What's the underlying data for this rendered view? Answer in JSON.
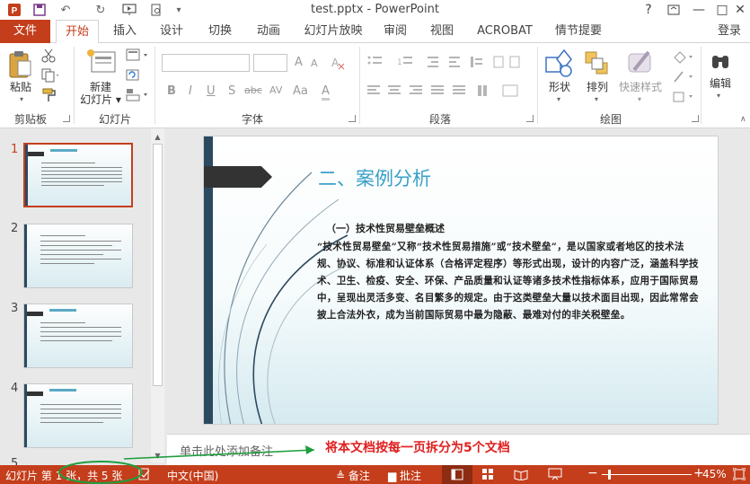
{
  "window": {
    "title": "test.pptx - PowerPoint",
    "help": "?",
    "restore": "▢",
    "minimize": "—",
    "maximize": "□",
    "close": "✕"
  },
  "quick_access": {
    "save": "💾",
    "undo": "↶",
    "redo": "↻",
    "present": "▶",
    "preview": "🔍",
    "more": "▾"
  },
  "tabs": {
    "file": "文件",
    "items": [
      "开始",
      "插入",
      "设计",
      "切换",
      "动画",
      "幻灯片放映",
      "审阅",
      "视图",
      "ACROBAT",
      "情节提要"
    ],
    "active": "开始",
    "signin": "登录"
  },
  "ribbon": {
    "clipboard": {
      "paste": "粘贴",
      "label": "剪贴板"
    },
    "slides": {
      "new_slide_line1": "新建",
      "new_slide_line2": "幻灯片 ▾",
      "label": "幻灯片"
    },
    "font": {
      "label": "字体",
      "bold": "B",
      "italic": "I",
      "underline": "U",
      "shadow": "S",
      "strike": "abc",
      "spacing": "AV",
      "case": "Aa",
      "color": "A",
      "grow": "A",
      "shrink": "A"
    },
    "paragraph": {
      "label": "段落"
    },
    "drawing": {
      "shapes": "形状",
      "arrange": "排列",
      "quick_styles": "快速样式",
      "label": "绘图"
    },
    "editing": {
      "edit": "编辑"
    }
  },
  "slides": [
    {
      "number": "1",
      "selected": true
    },
    {
      "number": "2",
      "selected": false
    },
    {
      "number": "3",
      "selected": false
    },
    {
      "number": "4",
      "selected": false
    },
    {
      "number": "5",
      "selected": false
    }
  ],
  "slide": {
    "title": "二、案例分析",
    "subtitle": "（一）技术性贸易壁垒概述",
    "body": "“技术性贸易壁垒”又称“技术性贸易措施”或“技术壁垒”，是以国家或者地区的技术法规、协议、标准和认证体系（合格评定程序）等形式出现，设计的内容广泛，涵盖科学技术、卫生、检疫、安全、环保、产品质量和认证等诸多技术性指标体系，应用于国际贸易中，呈现出灵活多变、名目繁多的规定。由于这类壁垒大量以技术面目出现，因此常常会披上合法外衣，成为当前国际贸易中最为隐蔽、最难对付的非关税壁垒。"
  },
  "notes": {
    "placeholder": "单击此处添加备注"
  },
  "annotation": {
    "text": "将本文档按每一页拆分为5个文档"
  },
  "statusbar": {
    "slide_info": "幻灯片 第 1 张，共 5 张",
    "language": "中文(中国)",
    "notes": "≜ 备注",
    "comments": "▆ 批注",
    "zoom_minus": "−",
    "zoom_plus": "+",
    "zoom": "45%"
  },
  "colors": {
    "accent": "#c43e1c",
    "title_blue": "#3aa0c8",
    "annotation_red": "#e02020",
    "annotation_green": "#1e9e3e"
  }
}
